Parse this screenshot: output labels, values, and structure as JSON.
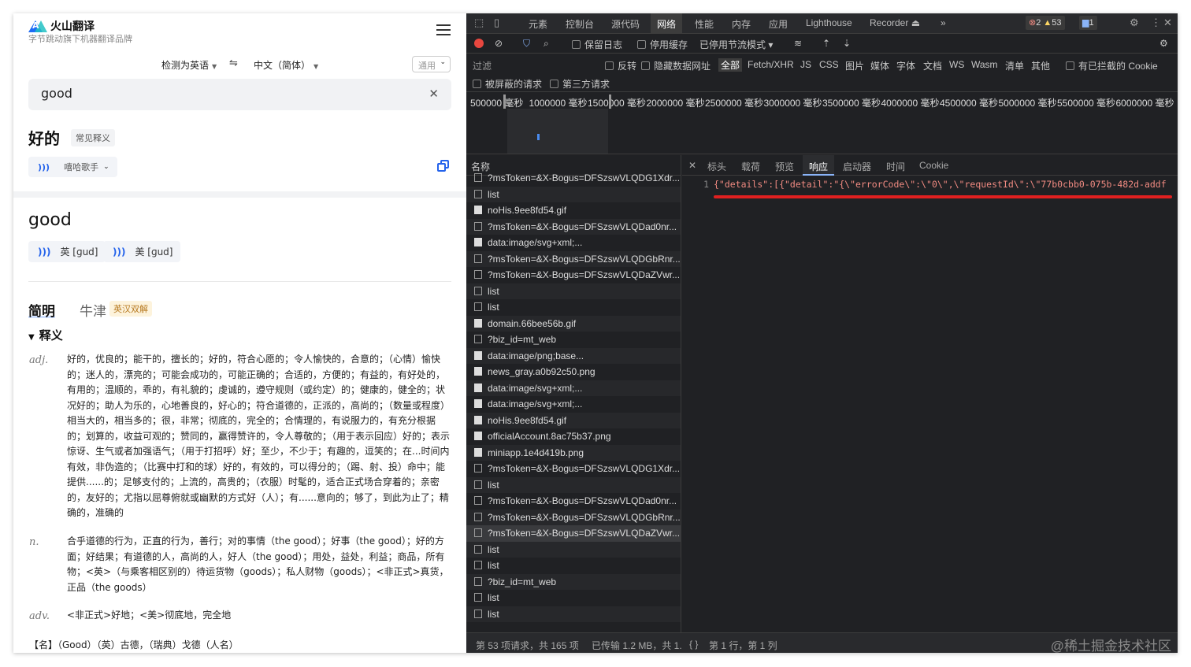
{
  "translator": {
    "brand_name": "火山翻译",
    "brand_sub": "字节跳动旗下机器翻译品牌",
    "source_lang": "检测为英语",
    "target_lang": "中文（简体）",
    "domain": "通用",
    "query": "good",
    "translation": "好的",
    "common_tag": "常见释义",
    "voice": "嘻哈歌手",
    "headword": "good",
    "pron_uk": "英 [ɡud]",
    "pron_us": "美 [ɡud]",
    "tab_simple": "简明",
    "tab_oxford": "牛津",
    "bilingual_tag": "英汉双解",
    "section": "释义",
    "adj_pos": "adj.",
    "adj_def": "好的，优良的；能干的，擅长的；好的，符合心愿的；令人愉快的，合意的；（心情）愉快的；迷人的，漂亮的；可能会成功的，可能正确的；合适的，方便的；有益的，有好处的，有用的；温顺的，乖的，有礼貌的；虔诚的，遵守规则（或约定）的；健康的，健全的；状况好的；助人为乐的，心地善良的，好心的；符合道德的，正派的，高尚的；（数量或程度）相当大的，相当多的；很，非常；彻底的，完全的；合情理的，有说服力的，有充分根据的；划算的，收益可观的；赞同的，赢得赞许的，令人尊敬的；（用于表示回应）好的；表示惊讶、生气或者加强语气；（用于打招呼）好；至少，不少于；有趣的，逗笑的；在...时间内有效，非伪造的；（比赛中打和的球）好的，有效的，可以得分的；（踢、射、投）命中；能提供......的；足够支付的；上流的，高贵的；（衣服）时髦的，适合正式场合穿着的；亲密的，友好的；尤指以屈尊俯就或幽默的方式好（人）；有......意向的；够了，到此为止了；精确的，准确的",
    "n_pos": "n.",
    "n_def": "合乎道德的行为，正直的行为，善行；对的事情（the good）；好事（the good）；好的方面；好结果；有道德的人，高尚的人，好人（the good）；用处，益处，利益；商品，所有物；<英>（与乘客相区别的）待运货物（goods）；私人财物（goods）；<非正式>真货，正品（the goods）",
    "adv_pos": "adv.",
    "adv_def": "<非正式>好地；<美>彻底地，完全地",
    "name_row": "【名】（Good）（英）古德，（瑞典）戈德（人名）"
  },
  "devtools": {
    "tabs": [
      "元素",
      "控制台",
      "源代码",
      "网络",
      "性能",
      "内存",
      "应用",
      "Lighthouse",
      "Recorder ⏏",
      "»"
    ],
    "active_tab": "网络",
    "errors": "2",
    "warnings": "53",
    "messages": "1",
    "toolbar": {
      "preserve_log": "保留日志",
      "disable_cache": "停用缓存",
      "throttle": "已停用节流模式"
    },
    "filter": {
      "label": "过滤",
      "invert": "反转",
      "hide_data_urls": "隐藏数据网址",
      "types": [
        "全部",
        "Fetch/XHR",
        "JS",
        "CSS",
        "图片",
        "媒体",
        "字体",
        "文档",
        "WS",
        "Wasm",
        "清单",
        "其他"
      ],
      "blocked_cookies": "有已拦截的 Cookie",
      "blocked_requests": "被屏蔽的请求",
      "third_party": "第三方请求"
    },
    "timeline_labels": [
      "500000 毫秒",
      "1000000 毫秒",
      "1500000 毫秒",
      "2000000 毫秒",
      "2500000 毫秒",
      "3000000 毫秒",
      "3500000 毫秒",
      "4000000 毫秒",
      "4500000 毫秒",
      "5000000 毫秒",
      "5500000 毫秒",
      "6000000 毫秒"
    ],
    "name_header": "名称",
    "requests": [
      {
        "name": "?msToken=&X-Bogus=DFSzswVLQDG1Xdr...",
        "icon": "doc"
      },
      {
        "name": "list",
        "icon": "doc"
      },
      {
        "name": "noHis.9ee8fd54.gif",
        "icon": "img"
      },
      {
        "name": "?msToken=&X-Bogus=DFSzswVLQDad0nr...",
        "icon": "doc"
      },
      {
        "name": "data:image/svg+xml;...",
        "icon": "img"
      },
      {
        "name": "?msToken=&X-Bogus=DFSzswVLQDGbRnr...",
        "icon": "doc"
      },
      {
        "name": "?msToken=&X-Bogus=DFSzswVLQDaZVwr...",
        "icon": "doc"
      },
      {
        "name": "list",
        "icon": "doc"
      },
      {
        "name": "list",
        "icon": "doc"
      },
      {
        "name": "domain.66bee56b.gif",
        "icon": "img"
      },
      {
        "name": "?biz_id=mt_web",
        "icon": "doc"
      },
      {
        "name": "data:image/png;base...",
        "icon": "img"
      },
      {
        "name": "news_gray.a0b92c50.png",
        "icon": "img"
      },
      {
        "name": "data:image/svg+xml;...",
        "icon": "img"
      },
      {
        "name": "data:image/svg+xml;...",
        "icon": "img"
      },
      {
        "name": "noHis.9ee8fd54.gif",
        "icon": "img"
      },
      {
        "name": "officialAccount.8ac75b37.png",
        "icon": "img"
      },
      {
        "name": "miniapp.1e4d419b.png",
        "icon": "img"
      },
      {
        "name": "?msToken=&X-Bogus=DFSzswVLQDG1Xdr...",
        "icon": "doc"
      },
      {
        "name": "list",
        "icon": "doc"
      },
      {
        "name": "?msToken=&X-Bogus=DFSzswVLQDad0nr...",
        "icon": "doc"
      },
      {
        "name": "?msToken=&X-Bogus=DFSzswVLQDGbRnr...",
        "icon": "doc"
      },
      {
        "name": "?msToken=&X-Bogus=DFSzswVLQDaZVwr...",
        "icon": "doc"
      },
      {
        "name": "list",
        "icon": "doc"
      },
      {
        "name": "list",
        "icon": "doc"
      },
      {
        "name": "?biz_id=mt_web",
        "icon": "doc"
      },
      {
        "name": "list",
        "icon": "doc"
      },
      {
        "name": "list",
        "icon": "doc"
      }
    ],
    "selected_request": 22,
    "detail_tabs": [
      "标头",
      "载荷",
      "预览",
      "响应",
      "启动器",
      "时间",
      "Cookie"
    ],
    "active_detail_tab": "响应",
    "response_line_number": "1",
    "response_text": "{\"details\":[{\"detail\":\"{\\\"errorCode\\\":\\\"0\\\",\\\"requestId\\\":\\\"77b0cbb0-075b-482d-addf",
    "status_requests": "第 53 项请求，共 165 项",
    "status_transferred": "已传输 1.2 MB，共 1.",
    "status_position": "第 1 行，第 1 列",
    "watermark": "@稀土掘金技术社区"
  }
}
